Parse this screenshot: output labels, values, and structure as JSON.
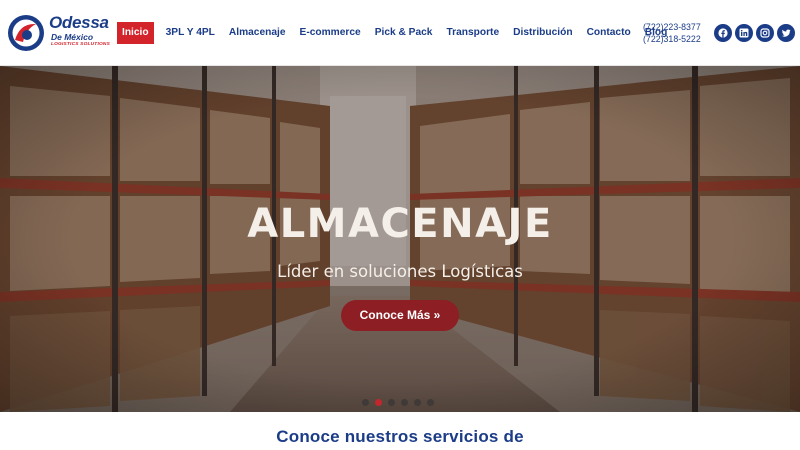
{
  "logo": {
    "name": "Odessa",
    "sub": "De México",
    "tag": "LOGISTICS SOLUTIONS"
  },
  "nav": {
    "items": [
      {
        "label": "Inicio",
        "active": true
      },
      {
        "label": "3PL Y 4PL"
      },
      {
        "label": "Almacenaje"
      },
      {
        "label": "E-commerce"
      },
      {
        "label": "Pick & Pack"
      },
      {
        "label": "Transporte"
      },
      {
        "label": "Distribución"
      },
      {
        "label": "Contacto"
      },
      {
        "label": "Blog"
      }
    ]
  },
  "contact": {
    "phone1": "(722)223-8377",
    "phone2": "(722)318-5222"
  },
  "social": [
    "facebook-icon",
    "linkedin-icon",
    "instagram-icon",
    "twitter-icon"
  ],
  "hero": {
    "title": "ALMACENAJE",
    "subtitle": "Líder en soluciones Logísticas",
    "button_label": "Conoce Más »",
    "slides_count": 6,
    "active_slide": 2
  },
  "section": {
    "heading": "Conoce nuestros servicios de"
  },
  "colors": {
    "brand_blue": "#1b3c87",
    "brand_red": "#d3232b",
    "button_red": "#8d1e24"
  }
}
